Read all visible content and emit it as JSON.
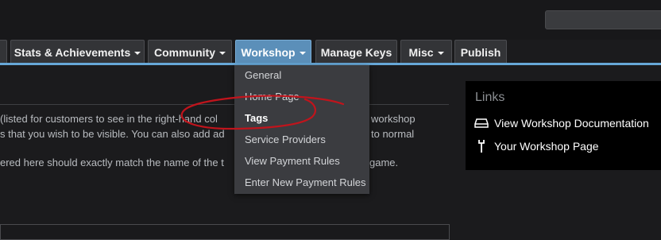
{
  "tabs": [
    {
      "label": "",
      "dropdown": false
    },
    {
      "label": "Stats & Achievements",
      "dropdown": true
    },
    {
      "label": "Community",
      "dropdown": true
    },
    {
      "label": "Workshop",
      "dropdown": true,
      "active": true
    },
    {
      "label": "Manage Keys",
      "dropdown": false
    },
    {
      "label": "Misc",
      "dropdown": true
    },
    {
      "label": "Publish",
      "dropdown": false
    }
  ],
  "workshop_menu": {
    "items": [
      {
        "label": "General"
      },
      {
        "label": "Home Page"
      },
      {
        "label": "Tags",
        "selected": true
      },
      {
        "label": "Service Providers"
      },
      {
        "label": "View Payment Rules"
      },
      {
        "label": "Enter New Payment Rules"
      }
    ]
  },
  "main": {
    "lines": [
      "(listed for customers to see in the right-hand col",
      "s that you wish to be visible. You can also add ad",
      "ered here should exactly match the name of the t"
    ],
    "right_fragments": [
      "workshop",
      "to normal",
      "game."
    ]
  },
  "links": {
    "title": "Links",
    "items": [
      {
        "label": "View Workshop Documentation",
        "icon": "drive-icon"
      },
      {
        "label": "Your Workshop Page",
        "icon": "wrench-icon"
      }
    ]
  },
  "colors": {
    "accent": "#67a8d8",
    "active_tab": "#5b8fb9",
    "annotation": "#c0141c"
  }
}
